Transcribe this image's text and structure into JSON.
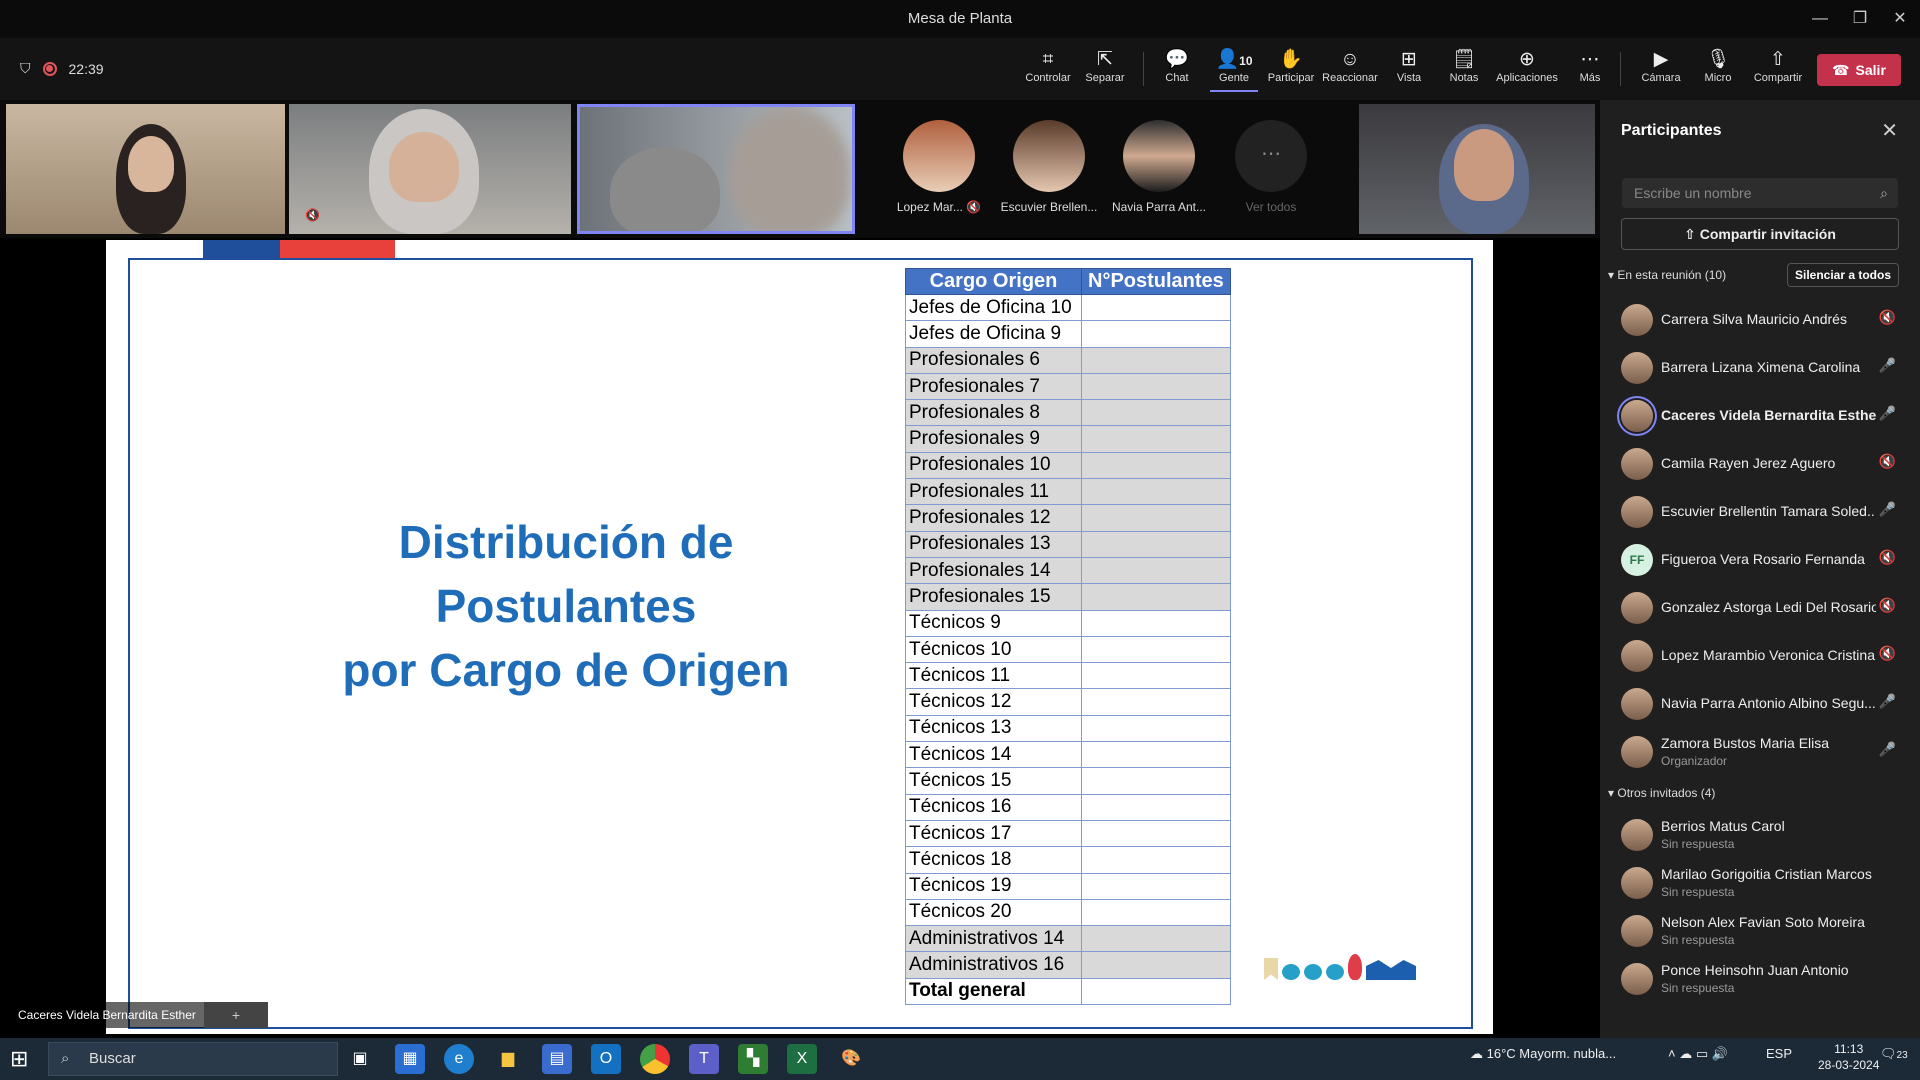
{
  "window": {
    "title": "Mesa de Planta",
    "min": "—",
    "restore": "❐",
    "close": "✕"
  },
  "meeting": {
    "timer": "22:39"
  },
  "toolbar": {
    "controlar": "Controlar",
    "separar": "Separar",
    "chat": "Chat",
    "gente": "Gente",
    "gente_count": "10",
    "participar": "Participar",
    "reaccionar": "Reaccionar",
    "vista": "Vista",
    "notas": "Notas",
    "aplicaciones": "Aplicaciones",
    "mas": "Más",
    "camara": "Cámara",
    "micro": "Micro",
    "compartir": "Compartir",
    "salir": "Salir"
  },
  "gallery": {
    "avatars": [
      {
        "name": "Lopez Mar..."
      },
      {
        "name": "Escuvier Brellen..."
      },
      {
        "name": "Navia Parra Ant..."
      }
    ],
    "ver_todos": "Ver todos"
  },
  "slide": {
    "title_line1": "Distribución de Postulantes",
    "title_line2": "por Cargo de Origen",
    "table": {
      "headers": [
        "Cargo Origen",
        "N°Postulantes"
      ],
      "rows": [
        "Jefes de Oficina 10",
        "Jefes de Oficina 9",
        "Profesionales 6",
        "Profesionales 7",
        "Profesionales 8",
        "Profesionales 9",
        "Profesionales 10",
        "Profesionales 11",
        "Profesionales 12",
        "Profesionales 13",
        "Profesionales 14",
        "Profesionales 15",
        "Técnicos 9",
        "Técnicos 10",
        "Técnicos 11",
        "Técnicos 12",
        "Técnicos 13",
        "Técnicos 14",
        "Técnicos 15",
        "Técnicos 16",
        "Técnicos 17",
        "Técnicos 18",
        "Técnicos 19",
        "Técnicos 20",
        "Administrativos 14",
        "Administrativos 16"
      ],
      "total": "Total general"
    },
    "colors": {
      "title": "#1f6db8",
      "table_header": "#4472c4",
      "flag_blue": "#1f4e9a",
      "flag_red": "#e8413c"
    }
  },
  "presenter": {
    "name": "Caceres Videla Bernardita Esther"
  },
  "panel": {
    "title": "Participantes",
    "search_placeholder": "Escribe un nombre",
    "invite": "Compartir invitación",
    "in_meeting": "En esta reunión (10)",
    "mute_all": "Silenciar a todos",
    "participants": [
      {
        "name": "Carrera Silva Mauricio Andrés",
        "mic": "off"
      },
      {
        "name": "Barrera Lizana Ximena Carolina",
        "mic": "on"
      },
      {
        "name": "Caceres Videla Bernardita Esther",
        "mic": "on"
      },
      {
        "name": "Camila Rayen Jerez Aguero",
        "mic": "off"
      },
      {
        "name": "Escuvier Brellentin Tamara Soled...",
        "mic": "on"
      },
      {
        "name": "Figueroa Vera Rosario Fernanda",
        "initials": "FF",
        "mic": "off"
      },
      {
        "name": "Gonzalez Astorga Ledi Del Rosario",
        "mic": "off"
      },
      {
        "name": "Lopez Marambio Veronica Cristina",
        "mic": "off"
      },
      {
        "name": "Navia Parra Antonio Albino Segu...",
        "mic": "on"
      },
      {
        "name": "Zamora Bustos Maria Elisa",
        "role": "Organizador",
        "mic": "on"
      }
    ],
    "others": "Otros invitados (4)",
    "invited": [
      {
        "name": "Berrios Matus Carol",
        "status": "Sin respuesta"
      },
      {
        "name": "Marilao Gorigoitia Cristian Marcos",
        "status": "Sin respuesta"
      },
      {
        "name": "Nelson Alex Favian Soto Moreira",
        "status": "Sin respuesta"
      },
      {
        "name": "Ponce Heinsohn Juan Antonio",
        "status": "Sin respuesta"
      }
    ]
  },
  "taskbar": {
    "search": "Buscar",
    "weather": "16°C  Mayorm. nubla...",
    "lang": "ESP",
    "time": "11:13",
    "date": "28-03-2024",
    "notif": "23"
  }
}
